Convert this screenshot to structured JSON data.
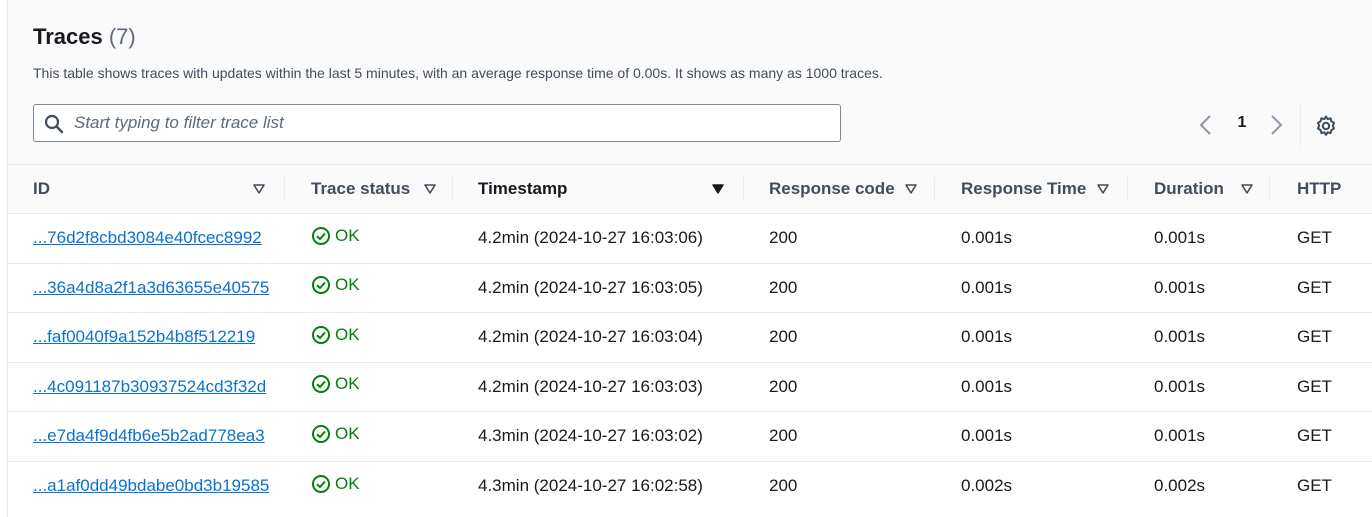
{
  "header": {
    "title": "Traces",
    "count": "(7)",
    "description": "This table shows traces with updates within the last 5 minutes, with an average response time of 0.00s. It shows as many as 1000 traces."
  },
  "search": {
    "placeholder": "Start typing to filter trace list",
    "value": ""
  },
  "pagination": {
    "current_page": "1"
  },
  "icons": {
    "search": "search-icon",
    "prev": "chevron-left-icon",
    "next": "chevron-right-icon",
    "settings": "gear-icon",
    "status_ok": "check-circle-icon",
    "sort": "caret-down-icon"
  },
  "colors": {
    "link": "#0972d3",
    "ok": "#037f0c",
    "header_bg": "#fafafa",
    "border": "#e9ebed"
  },
  "table": {
    "columns": [
      "ID",
      "Trace status",
      "Timestamp",
      "Response code",
      "Response Time",
      "Duration",
      "HTTP"
    ],
    "sorted_column": "Timestamp",
    "rows": [
      {
        "id": "...76d2f8cbd3084e40fcec8992",
        "status": "OK",
        "timestamp": "4.2min (2024-10-27 16:03:06)",
        "response_code": "200",
        "response_time": "0.001s",
        "duration": "0.001s",
        "http": "GET"
      },
      {
        "id": "...36a4d8a2f1a3d63655e40575",
        "status": "OK",
        "timestamp": "4.2min (2024-10-27 16:03:05)",
        "response_code": "200",
        "response_time": "0.001s",
        "duration": "0.001s",
        "http": "GET"
      },
      {
        "id": "...faf0040f9a152b4b8f512219",
        "status": "OK",
        "timestamp": "4.2min (2024-10-27 16:03:04)",
        "response_code": "200",
        "response_time": "0.001s",
        "duration": "0.001s",
        "http": "GET"
      },
      {
        "id": "...4c091187b30937524cd3f32d",
        "status": "OK",
        "timestamp": "4.2min (2024-10-27 16:03:03)",
        "response_code": "200",
        "response_time": "0.001s",
        "duration": "0.001s",
        "http": "GET"
      },
      {
        "id": "...e7da4f9d4fb6e5b2ad778ea3",
        "status": "OK",
        "timestamp": "4.3min (2024-10-27 16:03:02)",
        "response_code": "200",
        "response_time": "0.001s",
        "duration": "0.001s",
        "http": "GET"
      },
      {
        "id": "...a1af0dd49bdabe0bd3b19585",
        "status": "OK",
        "timestamp": "4.3min (2024-10-27 16:02:58)",
        "response_code": "200",
        "response_time": "0.002s",
        "duration": "0.002s",
        "http": "GET"
      }
    ]
  }
}
